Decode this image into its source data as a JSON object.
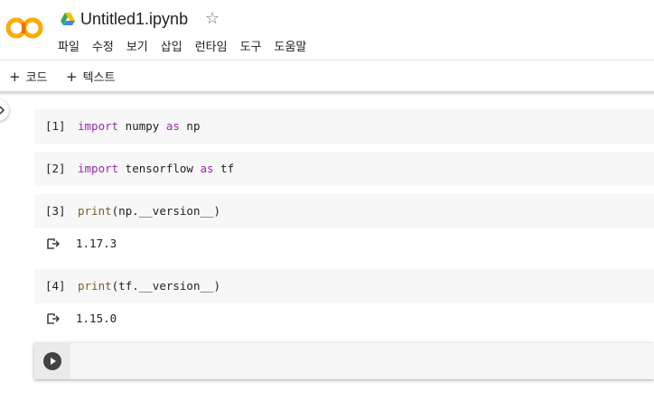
{
  "header": {
    "logo_text": "CO",
    "title": "Untitled1.ipynb",
    "star": "☆",
    "menu": [
      "파일",
      "수정",
      "보기",
      "삽입",
      "런타임",
      "도구",
      "도움말"
    ]
  },
  "toolbar": {
    "add_code": "코드",
    "add_text": "텍스트",
    "plus": "+"
  },
  "cells": [
    {
      "num": "[1]",
      "tokens": [
        {
          "t": "import",
          "c": "kw"
        },
        {
          "t": " numpy ",
          "c": ""
        },
        {
          "t": "as",
          "c": "kw"
        },
        {
          "t": " np",
          "c": ""
        }
      ]
    },
    {
      "num": "[2]",
      "tokens": [
        {
          "t": "import",
          "c": "kw"
        },
        {
          "t": " tensorflow ",
          "c": ""
        },
        {
          "t": "as",
          "c": "kw"
        },
        {
          "t": " tf",
          "c": ""
        }
      ]
    },
    {
      "num": "[3]",
      "tokens": [
        {
          "t": "print",
          "c": "fn"
        },
        {
          "t": "(np.__version__)",
          "c": ""
        }
      ],
      "output": "1.17.3"
    },
    {
      "num": "[4]",
      "tokens": [
        {
          "t": "print",
          "c": "fn"
        },
        {
          "t": "(tf.__version__)",
          "c": ""
        }
      ],
      "output": "1.15.0"
    }
  ],
  "colors": {
    "accent_orange": "#f9ab00",
    "keyword": "#9c27b0",
    "function": "#795e26"
  }
}
